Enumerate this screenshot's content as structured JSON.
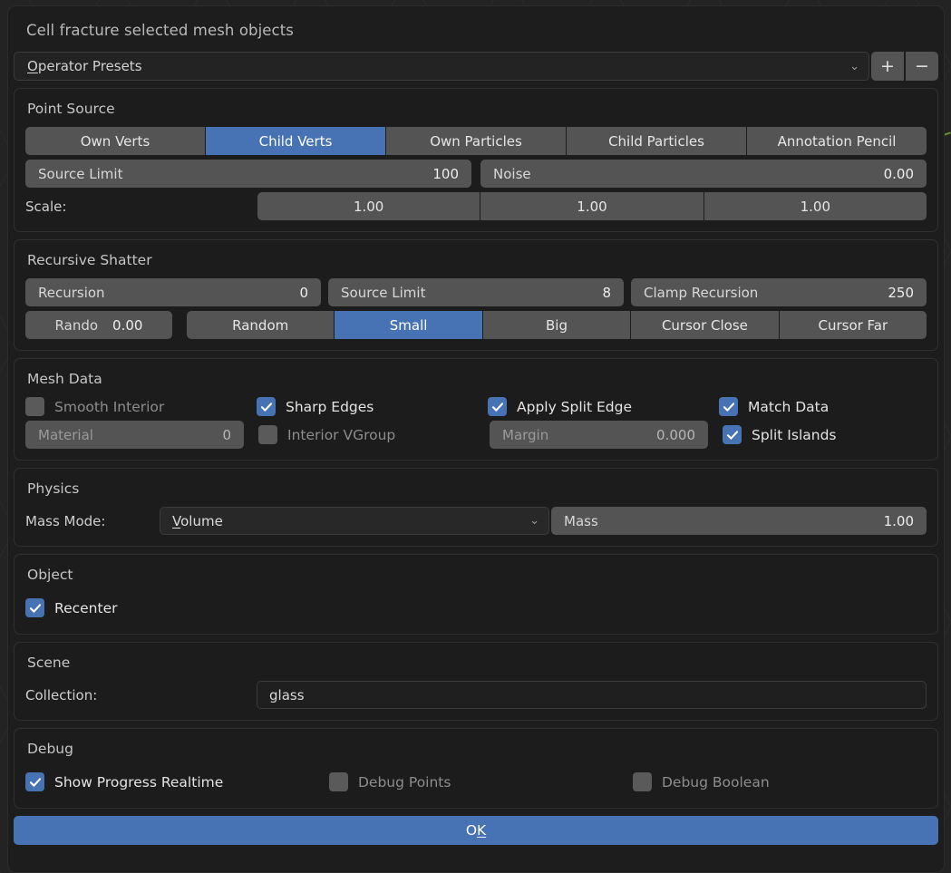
{
  "dialog": {
    "title": "Cell fracture selected mesh objects",
    "ok_label": "OK",
    "ok_accel": "K"
  },
  "preset": {
    "label": "perator Presets",
    "accel": "O",
    "add_icon": "+",
    "remove_icon": "−",
    "chevron_icon": "⌄"
  },
  "point_source": {
    "title": "Point Source",
    "toggles": [
      {
        "label": "Own Verts",
        "active": false
      },
      {
        "label": "Child Verts",
        "active": true
      },
      {
        "label": "Own Particles",
        "active": false
      },
      {
        "label": "Child Particles",
        "active": false
      },
      {
        "label": "Annotation Pencil",
        "active": false
      }
    ],
    "source_limit": {
      "label": "Source Limit",
      "value": "100"
    },
    "noise": {
      "label": "Noise",
      "value": "0.00"
    },
    "scale_label": "Scale:",
    "scale": [
      "1.00",
      "1.00",
      "1.00"
    ]
  },
  "recursive_shatter": {
    "title": "Recursive Shatter",
    "recursion": {
      "label": "Recursion",
      "value": "0"
    },
    "source_limit": {
      "label": "Source Limit",
      "value": "8"
    },
    "clamp_recursion": {
      "label": "Clamp Recursion",
      "value": "250"
    },
    "rando": {
      "label": "Rando",
      "value": "0.00"
    },
    "toggles": [
      {
        "label": "Random",
        "active": false
      },
      {
        "label": "Small",
        "active": true
      },
      {
        "label": "Big",
        "active": false
      },
      {
        "label": "Cursor Close",
        "active": false
      },
      {
        "label": "Cursor Far",
        "active": false
      }
    ]
  },
  "mesh_data": {
    "title": "Mesh Data",
    "smooth_interior": {
      "label": "Smooth Interior",
      "checked": false
    },
    "sharp_edges": {
      "label": "Sharp Edges",
      "checked": true
    },
    "apply_split_edge": {
      "label": "Apply Split Edge",
      "checked": true
    },
    "match_data": {
      "label": "Match Data",
      "checked": true
    },
    "material": {
      "label": "Material",
      "value": "0"
    },
    "interior_vgroup": {
      "label": "Interior VGroup",
      "checked": false
    },
    "margin": {
      "label": "Margin",
      "value": "0.000"
    },
    "split_islands": {
      "label": "Split Islands",
      "checked": true
    }
  },
  "physics": {
    "title": "Physics",
    "mass_mode_label": "Mass Mode:",
    "mass_mode_value": "olume",
    "mass_mode_accel": "V",
    "mass": {
      "label": "Mass",
      "value": "1.00"
    },
    "chevron_icon": "⌄"
  },
  "object": {
    "title": "Object",
    "recenter": {
      "label": "Recenter",
      "checked": true
    }
  },
  "scene": {
    "title": "Scene",
    "collection_label": "Collection:",
    "collection_value": "glass"
  },
  "debug": {
    "title": "Debug",
    "show_progress_realtime": {
      "label": "Show Progress Realtime",
      "checked": true
    },
    "debug_points": {
      "label": "Debug Points",
      "checked": false
    },
    "debug_boolean": {
      "label": "Debug Boolean",
      "checked": false
    }
  },
  "colors": {
    "accent": "#4772b3",
    "widget": "#545454",
    "panel_bg": "#1c1c1c",
    "dialog_bg": "#1d1d1d"
  }
}
